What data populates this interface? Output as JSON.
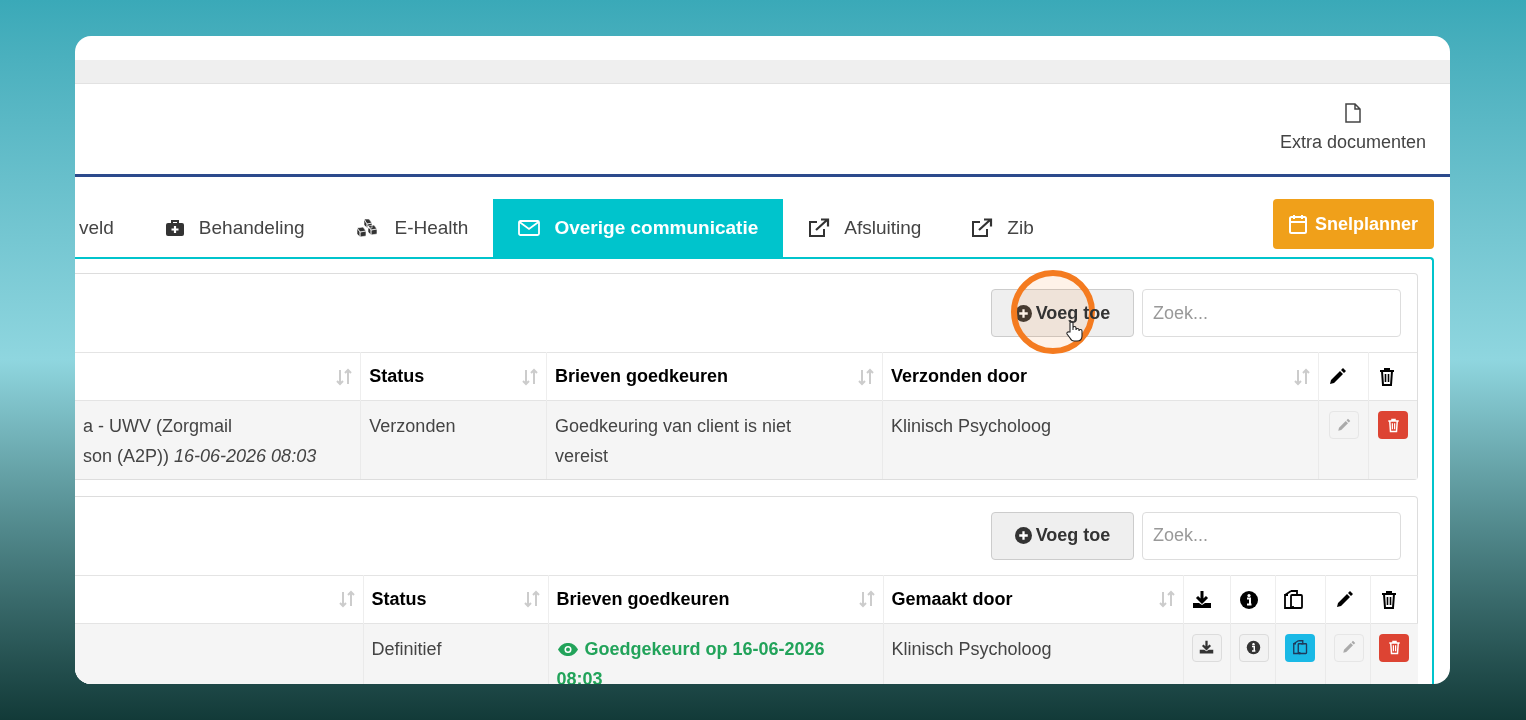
{
  "header": {
    "extra_documents": "Extra documenten"
  },
  "tabs": [
    {
      "label": "veld",
      "selected": false
    },
    {
      "label": "Behandeling",
      "selected": false
    },
    {
      "label": "E-Health",
      "selected": false
    },
    {
      "label": "Overige communicatie",
      "selected": true
    },
    {
      "label": "Afsluiting",
      "selected": false
    },
    {
      "label": "Zib",
      "selected": false
    }
  ],
  "snelplanner": {
    "label": "Snelplanner"
  },
  "tables": [
    {
      "add_button": "Voeg toe",
      "search_placeholder": "Zoek...",
      "columns": [
        {
          "kind": "text"
        },
        {
          "kind": "text",
          "label": "Status"
        },
        {
          "kind": "text",
          "label": "Brieven goedkeuren"
        },
        {
          "kind": "text",
          "label": "Verzonden door"
        },
        {
          "kind": "edit"
        },
        {
          "kind": "delete"
        }
      ],
      "rows": [
        {
          "cells": [
            {
              "kind": "text",
              "text": "a - UWV (Zorgmail\nson (A2P)) *16-06-2026 08:03*"
            },
            {
              "kind": "text",
              "text": "Verzonden"
            },
            {
              "kind": "text",
              "text": "Goedkeuring van client is niet vereist"
            },
            {
              "kind": "text",
              "text": "Klinisch Psycholoog"
            },
            {
              "kind": "edit"
            },
            {
              "kind": "delete"
            }
          ]
        }
      ]
    },
    {
      "add_button": "Voeg toe",
      "search_placeholder": "Zoek...",
      "columns": [
        {
          "kind": "text"
        },
        {
          "kind": "text",
          "label": "Status"
        },
        {
          "kind": "text",
          "label": "Brieven goedkeuren"
        },
        {
          "kind": "text",
          "label": "Gemaakt door"
        },
        {
          "kind": "download"
        },
        {
          "kind": "info"
        },
        {
          "kind": "copy"
        },
        {
          "kind": "edit"
        },
        {
          "kind": "delete"
        }
      ],
      "rows": [
        {
          "cells": [
            {
              "kind": "empty"
            },
            {
              "kind": "text",
              "text": "Definitief"
            },
            {
              "kind": "approved",
              "text": "Goedgekeurd op 16-06-2026 08:03"
            },
            {
              "kind": "text",
              "text": "Klinisch Psycholoog"
            },
            {
              "kind": "download"
            },
            {
              "kind": "info"
            },
            {
              "kind": "copy"
            },
            {
              "kind": "edit"
            },
            {
              "kind": "delete"
            }
          ]
        }
      ]
    }
  ]
}
